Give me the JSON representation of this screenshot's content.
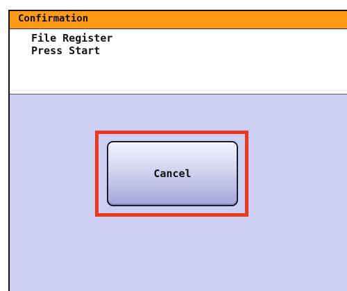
{
  "dialog": {
    "title": "Confirmation",
    "messages": [
      "File Register",
      "Press Start"
    ]
  },
  "actions": {
    "cancel_label": "Cancel"
  },
  "colors": {
    "title_bar": "#ff9a16",
    "body_background": "#cccff2",
    "message_background": "#ffffff",
    "highlight": "#e8381f"
  }
}
